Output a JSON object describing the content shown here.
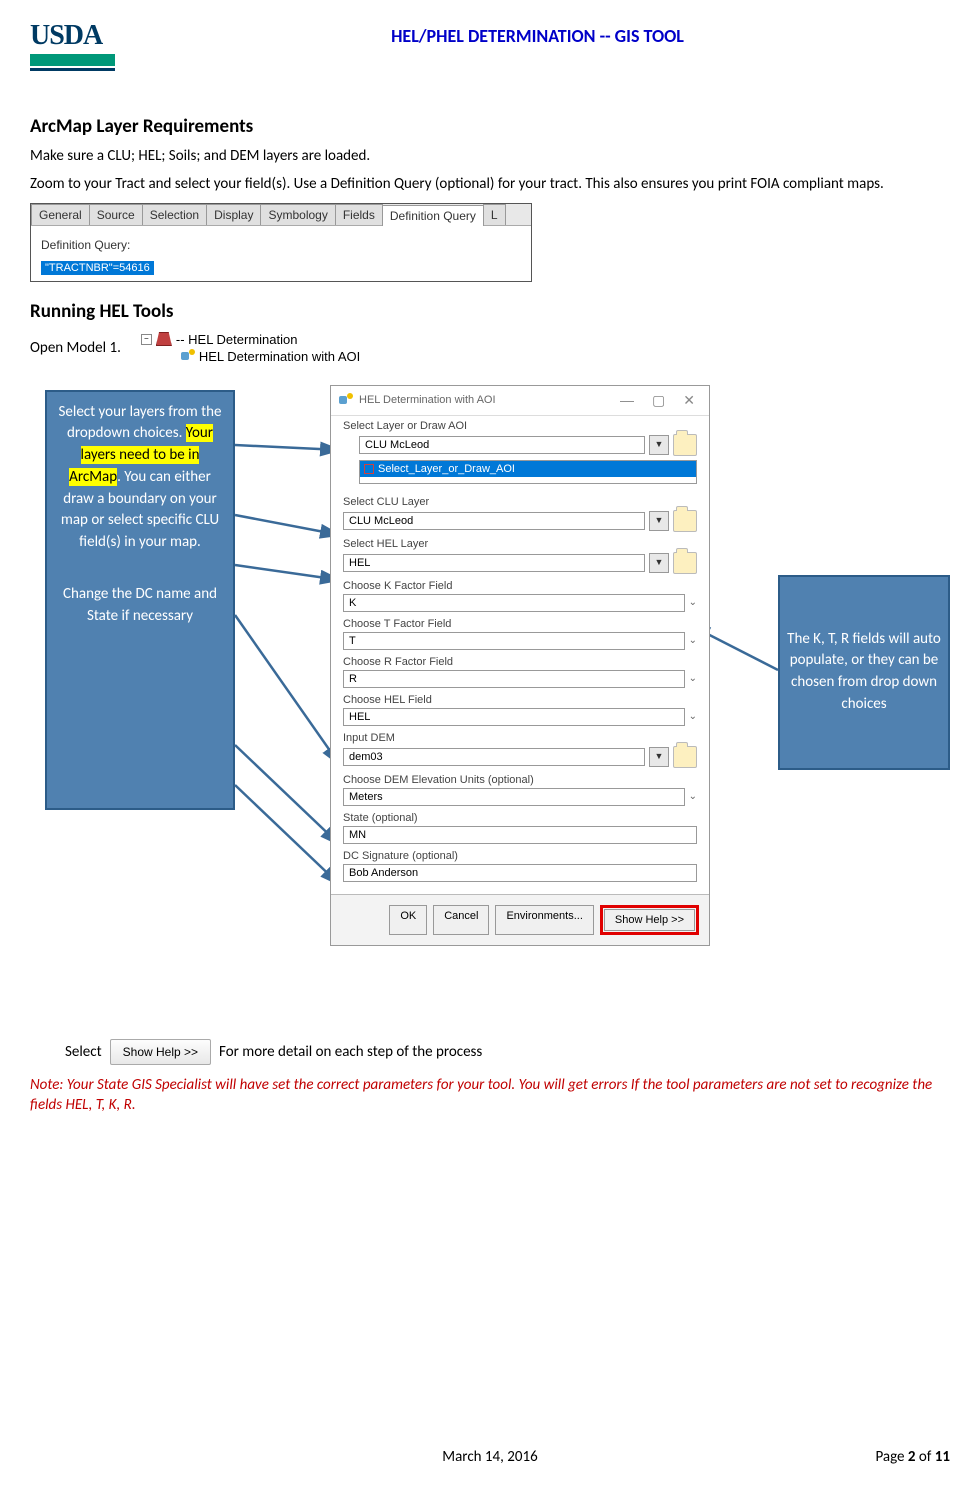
{
  "header": {
    "logo_text": "USDA",
    "doc_title": "HEL/PHEL DETERMINATION -- GIS TOOL"
  },
  "section1": {
    "title": "ArcMap Layer Requirements",
    "p1": "Make sure a CLU; HEL; Soils; and DEM layers are loaded.",
    "p2": "Zoom to your Tract and select your field(s). Use a Definition Query (optional) for your tract. This also ensures you print FOIA compliant maps."
  },
  "defq": {
    "tabs": [
      "General",
      "Source",
      "Selection",
      "Display",
      "Symbology",
      "Fields",
      "Definition Query",
      "L"
    ],
    "label": "Definition Query:",
    "query": "\"TRACTNBR\"=54616"
  },
  "section2": {
    "title": "Running HEL Tools",
    "open_text": "Open Model 1.",
    "tree_root": "-- HEL Determination",
    "tree_child": "HEL Determination with AOI"
  },
  "callouts": {
    "left_top_a": "Select your layers from the dropdown choices. ",
    "left_top_hl": "Your layers need to be in ArcMap",
    "left_top_b": ". You can either draw a boundary on your map or select specific CLU field(s) in your map.",
    "left_bottom": "Change the DC name and State if necessary",
    "right": "The K, T, R fields will auto populate, or they can be chosen from drop down choices"
  },
  "dlg": {
    "title": "HEL Determination with AOI",
    "fields": {
      "select_layer_label": "Select Layer or Draw AOI",
      "select_layer_value": "CLU McLeod",
      "layer_list_item": "Select_Layer_or_Draw_AOI",
      "clu_label": "Select CLU Layer",
      "clu_value": "CLU McLeod",
      "hel_label": "Select HEL Layer",
      "hel_value": "HEL",
      "k_label": "Choose K Factor Field",
      "k_value": "K",
      "t_label": "Choose T Factor Field",
      "t_value": "T",
      "r_label": "Choose R Factor Field",
      "r_value": "R",
      "helf_label": "Choose HEL Field",
      "helf_value": "HEL",
      "dem_label": "Input DEM",
      "dem_value": "dem03",
      "demu_label": "Choose DEM Elevation Units (optional)",
      "demu_value": "Meters",
      "state_label": "State (optional)",
      "state_value": "MN",
      "dc_label": "DC Signature (optional)",
      "dc_value": "Bob Anderson"
    },
    "buttons": {
      "ok": "OK",
      "cancel": "Cancel",
      "env": "Environments...",
      "help": "Show Help >>"
    }
  },
  "select_line": {
    "pre": "Select",
    "btn": "Show Help >>",
    "post": "For more detail on each step of the process"
  },
  "note": "Note: Your State GIS Specialist will have set the correct parameters for your tool. You will get errors If the tool parameters are not set to recognize the fields HEL, T, K, R.",
  "footer": {
    "date": "March 14, 2016",
    "page_label_pre": "Page ",
    "page_current": "2",
    "page_sep": " of ",
    "page_total": "11"
  }
}
